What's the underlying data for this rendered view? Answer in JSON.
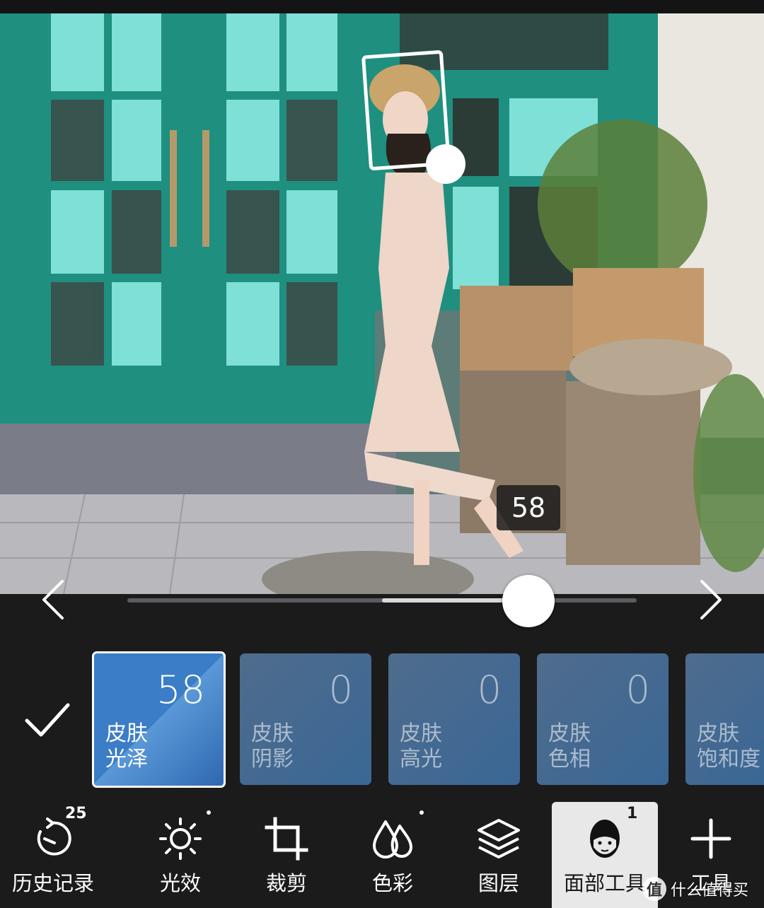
{
  "photo": {
    "description_icon": "photo-canvas",
    "value_tooltip": "58"
  },
  "slider": {
    "value": 58,
    "min": -100,
    "max": 100
  },
  "adjustments": [
    {
      "value": "58",
      "line1": "皮肤",
      "line2": "光泽",
      "active": true
    },
    {
      "value": "0",
      "line1": "皮肤",
      "line2": "阴影",
      "active": false
    },
    {
      "value": "0",
      "line1": "皮肤",
      "line2": "高光",
      "active": false
    },
    {
      "value": "0",
      "line1": "皮肤",
      "line2": "色相",
      "active": false
    },
    {
      "value": "",
      "line1": "皮肤",
      "line2": "饱和度",
      "active": false
    }
  ],
  "toolbar": {
    "history": {
      "label": "历史记录",
      "badge": "25",
      "icon": "history-icon"
    },
    "light": {
      "label": "光效",
      "icon": "sun-icon"
    },
    "crop": {
      "label": "裁剪",
      "icon": "crop-icon"
    },
    "color": {
      "label": "色彩",
      "icon": "color-drops-icon"
    },
    "layers": {
      "label": "图层",
      "icon": "layers-icon"
    },
    "face": {
      "label": "面部工具",
      "badge": "1",
      "icon": "face-icon"
    },
    "tools": {
      "label": "工具",
      "icon": "plus-icon"
    }
  },
  "watermark": {
    "logo": "值",
    "text": "什么值得买"
  },
  "colors": {
    "background": "#1b1b1c",
    "card": "#3d6690",
    "card_active": "#3b7dc6",
    "selected_tab": "#e8e8e8"
  }
}
